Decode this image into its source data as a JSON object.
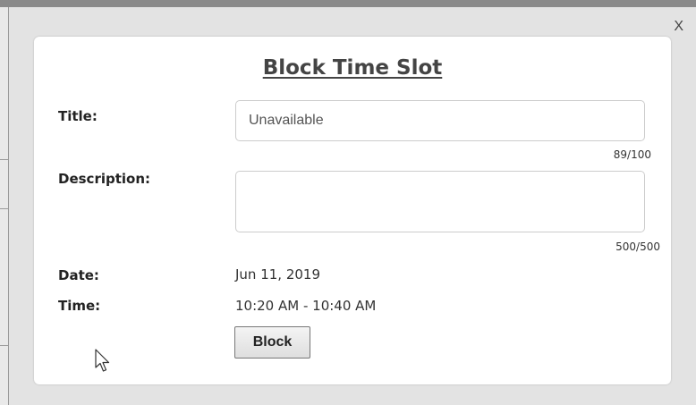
{
  "dialog": {
    "close_label": "X",
    "title": "Block Time Slot"
  },
  "form": {
    "title_label": "Title:",
    "title_value": "Unavailable",
    "title_counter": "89/100",
    "description_label": "Description:",
    "description_value": "",
    "description_counter": "500/500",
    "date_label": "Date:",
    "date_value": "Jun 11, 2019",
    "time_label": "Time:",
    "time_value": "10:20 AM - 10:40 AM",
    "block_label": "Block"
  },
  "colors": {
    "title": "#444444",
    "input_border": "#cccccc",
    "background": "#e3e3e3"
  },
  "icons": {
    "close": "close-icon",
    "cursor": "mouse-pointer-icon"
  }
}
